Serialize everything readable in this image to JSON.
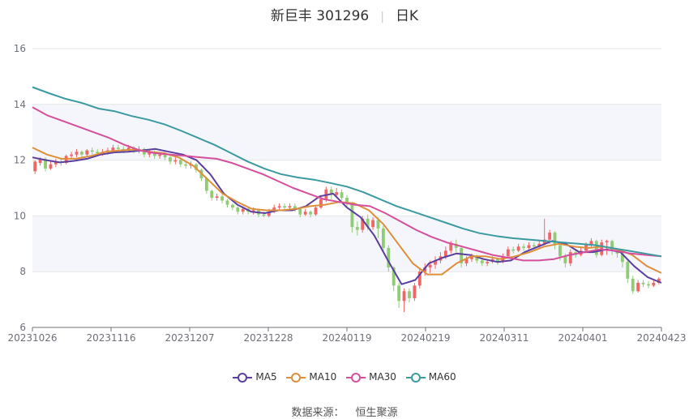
{
  "header": {
    "stock": "新巨丰 301296",
    "period": "日K"
  },
  "source": {
    "label": "数据来源：",
    "provider": "恒生聚源"
  },
  "colors": {
    "up": "#ee6666",
    "down": "#91cc75",
    "ma5": "#5b3f9e",
    "ma10": "#dd8f3b",
    "ma30": "#d54f9c",
    "ma60": "#3b9aa0",
    "band": "#f5f6fb",
    "grid": "#e6e6e6",
    "axis": "#6e7079"
  },
  "chart_data": {
    "type": "candlestick",
    "title": "新巨丰 301296 日K",
    "ylim": [
      6,
      16
    ],
    "yticks": [
      6,
      8,
      10,
      12,
      14,
      16
    ],
    "xticks": [
      "20231026",
      "20231116",
      "20231207",
      "20231228",
      "20240119",
      "20240219",
      "20240311",
      "20240401",
      "20240423"
    ],
    "bands": [
      [
        8,
        10
      ],
      [
        12,
        14
      ]
    ],
    "candles": [
      [
        11.6,
        11.95,
        11.5,
        12.0
      ],
      [
        11.9,
        12.05,
        11.8,
        12.1
      ],
      [
        12.05,
        11.7,
        11.6,
        12.1
      ],
      [
        11.7,
        11.85,
        11.65,
        11.95
      ],
      [
        11.85,
        11.95,
        11.75,
        12.05
      ],
      [
        11.95,
        11.9,
        11.8,
        12.05
      ],
      [
        11.9,
        12.15,
        11.85,
        12.2
      ],
      [
        12.15,
        12.2,
        12.05,
        12.3
      ],
      [
        12.2,
        12.3,
        12.1,
        12.4
      ],
      [
        12.3,
        12.2,
        12.1,
        12.35
      ],
      [
        12.2,
        12.35,
        12.15,
        12.4
      ],
      [
        12.35,
        12.3,
        12.2,
        12.45
      ],
      [
        12.3,
        12.25,
        12.15,
        12.4
      ],
      [
        12.25,
        12.3,
        12.15,
        12.4
      ],
      [
        12.3,
        12.35,
        12.2,
        12.45
      ],
      [
        12.35,
        12.45,
        12.3,
        12.55
      ],
      [
        12.45,
        12.4,
        12.3,
        12.55
      ],
      [
        12.4,
        12.35,
        12.25,
        12.5
      ],
      [
        12.35,
        12.45,
        12.3,
        12.55
      ],
      [
        12.45,
        12.35,
        12.25,
        12.5
      ],
      [
        12.35,
        12.4,
        12.25,
        12.5
      ],
      [
        12.4,
        12.2,
        12.1,
        12.45
      ],
      [
        12.2,
        12.3,
        12.1,
        12.4
      ],
      [
        12.3,
        12.15,
        12.05,
        12.35
      ],
      [
        12.15,
        12.2,
        12.05,
        12.3
      ],
      [
        12.2,
        12.1,
        12.0,
        12.3
      ],
      [
        12.1,
        11.95,
        11.85,
        12.15
      ],
      [
        11.95,
        12.0,
        11.85,
        12.1
      ],
      [
        12.0,
        11.85,
        11.75,
        12.05
      ],
      [
        11.85,
        11.8,
        11.7,
        11.95
      ],
      [
        11.8,
        11.85,
        11.7,
        11.95
      ],
      [
        11.85,
        11.65,
        11.55,
        11.9
      ],
      [
        11.65,
        11.35,
        11.25,
        11.7
      ],
      [
        11.35,
        10.9,
        10.8,
        11.4
      ],
      [
        10.9,
        10.65,
        10.55,
        10.95
      ],
      [
        10.65,
        10.7,
        10.55,
        10.8
      ],
      [
        10.7,
        10.55,
        10.45,
        10.8
      ],
      [
        10.55,
        10.4,
        10.3,
        10.6
      ],
      [
        10.4,
        10.3,
        10.2,
        10.45
      ],
      [
        10.3,
        10.15,
        10.05,
        10.35
      ],
      [
        10.15,
        10.25,
        10.05,
        10.35
      ],
      [
        10.25,
        10.15,
        10.05,
        10.3
      ],
      [
        10.15,
        10.2,
        10.05,
        10.3
      ],
      [
        10.2,
        10.05,
        9.95,
        10.25
      ],
      [
        10.05,
        10.0,
        9.95,
        10.15
      ],
      [
        10.0,
        10.15,
        9.95,
        10.25
      ],
      [
        10.15,
        10.3,
        10.1,
        10.4
      ],
      [
        10.3,
        10.35,
        10.2,
        10.45
      ],
      [
        10.35,
        10.3,
        10.2,
        10.45
      ],
      [
        10.3,
        10.35,
        10.25,
        10.45
      ],
      [
        10.35,
        10.25,
        10.15,
        10.45
      ],
      [
        10.25,
        10.05,
        9.95,
        10.3
      ],
      [
        10.05,
        10.15,
        10.0,
        10.25
      ],
      [
        10.15,
        10.05,
        9.95,
        10.2
      ],
      [
        10.05,
        10.3,
        10.0,
        10.4
      ],
      [
        10.3,
        10.6,
        10.25,
        10.75
      ],
      [
        10.6,
        10.95,
        10.5,
        11.05
      ],
      [
        10.95,
        10.75,
        10.6,
        11.05
      ],
      [
        10.75,
        10.85,
        10.65,
        11.0
      ],
      [
        10.85,
        10.65,
        10.55,
        10.95
      ],
      [
        10.65,
        10.45,
        10.3,
        10.75
      ],
      [
        10.45,
        9.6,
        9.4,
        10.5
      ],
      [
        9.6,
        9.5,
        9.3,
        9.8
      ],
      [
        9.5,
        9.9,
        9.4,
        10.0
      ],
      [
        9.9,
        9.6,
        9.5,
        10.05
      ],
      [
        9.6,
        9.85,
        9.5,
        9.95
      ],
      [
        9.85,
        9.55,
        9.2,
        9.95
      ],
      [
        9.55,
        8.85,
        8.7,
        9.65
      ],
      [
        8.85,
        8.15,
        8.0,
        8.95
      ],
      [
        8.15,
        7.5,
        7.3,
        8.2
      ],
      [
        7.5,
        6.95,
        6.7,
        7.6
      ],
      [
        6.95,
        7.3,
        6.55,
        7.4
      ],
      [
        7.3,
        7.05,
        6.9,
        7.4
      ],
      [
        7.05,
        7.5,
        6.95,
        7.6
      ],
      [
        7.5,
        8.0,
        7.4,
        8.1
      ],
      [
        8.0,
        8.15,
        7.85,
        8.3
      ],
      [
        8.15,
        8.25,
        7.95,
        8.4
      ],
      [
        8.25,
        8.4,
        8.1,
        8.55
      ],
      [
        8.4,
        8.55,
        8.3,
        8.7
      ],
      [
        8.55,
        8.75,
        8.45,
        8.9
      ],
      [
        8.75,
        9.0,
        8.65,
        9.1
      ],
      [
        9.0,
        8.85,
        8.7,
        9.15
      ],
      [
        8.85,
        8.3,
        8.15,
        8.95
      ],
      [
        8.3,
        8.45,
        8.2,
        8.55
      ],
      [
        8.45,
        8.55,
        8.35,
        8.65
      ],
      [
        8.55,
        8.4,
        8.3,
        8.6
      ],
      [
        8.4,
        8.3,
        8.2,
        8.45
      ],
      [
        8.3,
        8.35,
        8.2,
        8.45
      ],
      [
        8.35,
        8.45,
        8.3,
        8.55
      ],
      [
        8.45,
        8.35,
        8.25,
        8.5
      ],
      [
        8.35,
        8.55,
        8.3,
        8.65
      ],
      [
        8.55,
        8.8,
        8.5,
        8.9
      ],
      [
        8.8,
        8.75,
        8.65,
        8.9
      ],
      [
        8.75,
        8.9,
        8.7,
        9.0
      ],
      [
        8.9,
        8.85,
        8.75,
        9.0
      ],
      [
        8.85,
        8.95,
        8.8,
        9.05
      ],
      [
        8.95,
        8.9,
        8.8,
        9.05
      ],
      [
        8.9,
        9.0,
        8.85,
        9.1
      ],
      [
        9.0,
        9.15,
        8.95,
        9.9
      ],
      [
        9.15,
        9.4,
        9.0,
        9.5
      ],
      [
        9.4,
        8.95,
        8.8,
        9.45
      ],
      [
        8.95,
        8.55,
        8.4,
        9.05
      ],
      [
        8.55,
        8.3,
        8.15,
        8.65
      ],
      [
        8.3,
        8.7,
        8.2,
        8.8
      ],
      [
        8.7,
        8.6,
        8.5,
        8.8
      ],
      [
        8.6,
        8.75,
        8.55,
        8.85
      ],
      [
        8.75,
        8.95,
        8.7,
        9.05
      ],
      [
        8.95,
        9.1,
        8.85,
        9.2
      ],
      [
        9.1,
        8.6,
        8.5,
        9.15
      ],
      [
        8.6,
        9.05,
        8.55,
        9.15
      ],
      [
        9.05,
        9.1,
        8.6,
        9.15
      ],
      [
        9.1,
        8.75,
        8.6,
        9.15
      ],
      [
        8.75,
        8.65,
        8.5,
        8.8
      ],
      [
        8.65,
        8.35,
        8.15,
        8.75
      ],
      [
        8.35,
        7.75,
        7.6,
        8.4
      ],
      [
        7.75,
        7.3,
        7.2,
        7.85
      ],
      [
        7.3,
        7.6,
        7.25,
        7.7
      ],
      [
        7.6,
        7.55,
        7.45,
        7.7
      ],
      [
        7.55,
        7.5,
        7.4,
        7.65
      ],
      [
        7.5,
        7.6,
        7.45,
        7.7
      ],
      [
        7.6,
        7.75,
        7.55,
        7.8
      ]
    ],
    "series": [
      {
        "name": "MA5",
        "values": [
          12.1,
          12.0,
          11.92,
          11.97,
          12.05,
          12.2,
          12.28,
          12.3,
          12.35,
          12.4,
          12.3,
          12.2,
          12.0,
          11.5,
          10.8,
          10.4,
          10.15,
          10.1,
          10.2,
          10.2,
          10.35,
          10.7,
          10.8,
          10.3,
          9.95,
          9.3,
          8.4,
          7.55,
          7.7,
          8.3,
          8.5,
          8.65,
          8.6,
          8.45,
          8.35,
          8.4,
          8.7,
          8.9,
          9.1,
          9.0,
          8.7,
          8.7,
          8.8,
          8.7,
          8.2,
          7.8,
          7.6
        ]
      },
      {
        "name": "MA10",
        "values": [
          12.45,
          12.2,
          12.05,
          12.05,
          12.15,
          12.3,
          12.35,
          12.38,
          12.3,
          12.25,
          12.1,
          11.8,
          11.3,
          10.8,
          10.5,
          10.25,
          10.2,
          10.2,
          10.25,
          10.35,
          10.4,
          10.5,
          10.45,
          10.2,
          9.7,
          9.0,
          8.3,
          7.9,
          7.9,
          8.3,
          8.55,
          8.55,
          8.45,
          8.55,
          8.7,
          8.9,
          9.0,
          8.9,
          8.85,
          8.9,
          8.8,
          8.6,
          8.2,
          7.95
        ]
      },
      {
        "name": "MA30",
        "values": [
          13.9,
          13.6,
          13.4,
          13.2,
          13.0,
          12.8,
          12.55,
          12.35,
          12.25,
          12.2,
          12.15,
          12.1,
          12.05,
          11.9,
          11.7,
          11.5,
          11.25,
          11.0,
          10.8,
          10.6,
          10.5,
          10.4,
          10.35,
          10.1,
          9.8,
          9.5,
          9.25,
          9.05,
          8.9,
          8.75,
          8.6,
          8.5,
          8.4,
          8.4,
          8.45,
          8.6,
          8.7,
          8.8,
          8.75,
          8.65,
          8.6,
          8.55
        ]
      },
      {
        "name": "MA60",
        "values": [
          14.62,
          14.4,
          14.2,
          14.05,
          13.85,
          13.75,
          13.58,
          13.45,
          13.28,
          13.05,
          12.8,
          12.55,
          12.25,
          11.95,
          11.7,
          11.5,
          11.38,
          11.3,
          11.18,
          11.05,
          10.85,
          10.6,
          10.35,
          10.15,
          9.95,
          9.75,
          9.55,
          9.38,
          9.28,
          9.2,
          9.15,
          9.1,
          9.05,
          9.0,
          8.95,
          8.85,
          8.75,
          8.65,
          8.55
        ]
      }
    ]
  }
}
